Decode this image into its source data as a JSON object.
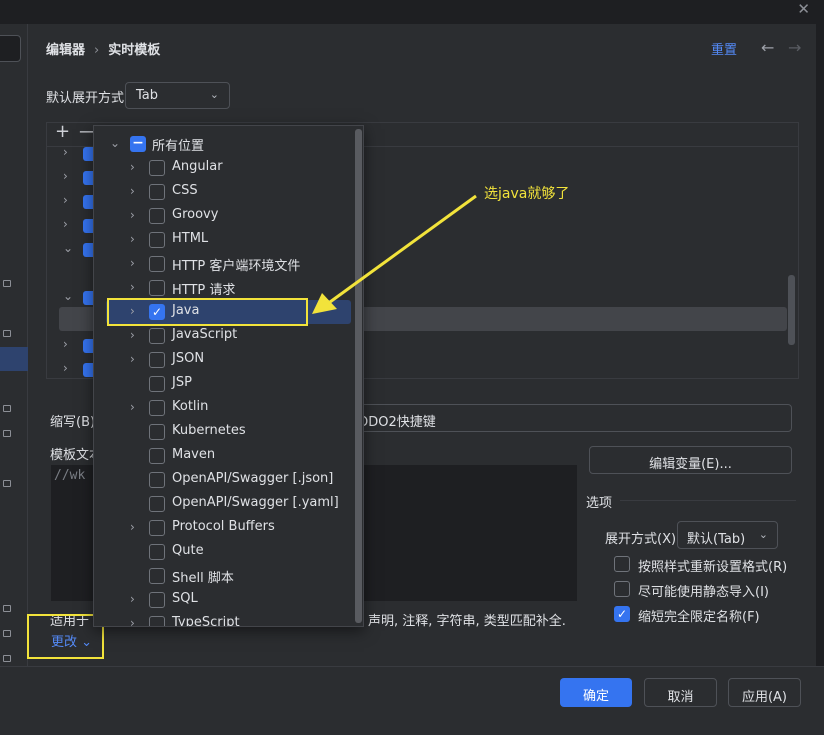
{
  "window": {
    "close_glyph": "✕"
  },
  "header": {
    "crumbs": [
      "编辑器",
      "实时模板"
    ],
    "separator": "›",
    "reset": "重置",
    "back_glyph": "←",
    "forward_glyph": "→"
  },
  "expand_default": {
    "label": "默认展开方式",
    "value": "Tab"
  },
  "tree_toolbar": {
    "add": "+",
    "remove": "—"
  },
  "popup": {
    "root": {
      "label": "所有位置",
      "state": "partial"
    },
    "items": [
      {
        "label": "Angular",
        "expandable": true,
        "checked": false
      },
      {
        "label": "CSS",
        "expandable": true,
        "checked": false
      },
      {
        "label": "Groovy",
        "expandable": true,
        "checked": false
      },
      {
        "label": "HTML",
        "expandable": true,
        "checked": false
      },
      {
        "label": "HTTP 客户端环境文件",
        "expandable": true,
        "checked": false
      },
      {
        "label": "HTTP 请求",
        "expandable": true,
        "checked": false
      },
      {
        "label": "Java",
        "expandable": true,
        "checked": true,
        "selected": true
      },
      {
        "label": "JavaScript",
        "expandable": true,
        "checked": false
      },
      {
        "label": "JSON",
        "expandable": true,
        "checked": false
      },
      {
        "label": "JSP",
        "expandable": false,
        "checked": false
      },
      {
        "label": "Kotlin",
        "expandable": true,
        "checked": false
      },
      {
        "label": "Kubernetes",
        "expandable": false,
        "checked": false
      },
      {
        "label": "Maven",
        "expandable": false,
        "checked": false
      },
      {
        "label": "OpenAPI/Swagger [.json]",
        "expandable": false,
        "checked": false
      },
      {
        "label": "OpenAPI/Swagger [.yaml]",
        "expandable": false,
        "checked": false
      },
      {
        "label": "Protocol Buffers",
        "expandable": true,
        "checked": false
      },
      {
        "label": "Qute",
        "expandable": false,
        "checked": false
      },
      {
        "label": "Shell 脚本",
        "expandable": false,
        "checked": false
      },
      {
        "label": "SQL",
        "expandable": true,
        "checked": false
      },
      {
        "label": "TypeScript",
        "expandable": true,
        "checked": false
      }
    ]
  },
  "annotation": {
    "text": "选java就够了",
    "color": "#f2e33b"
  },
  "editor": {
    "abbr_label": "缩写(B):",
    "description": "ODO2快捷键",
    "template_label": "模板文本",
    "template_text": "//wk",
    "edit_vars": "编辑变量(E)...",
    "applies_label": "适用于",
    "applies_tail": "声明, 注释, 字符串, 类型匹配补全.",
    "change": "更改 ⌄"
  },
  "options": {
    "title": "选项",
    "expand_label": "展开方式(X)",
    "expand_value": "默认(Tab)",
    "checkboxes": [
      {
        "label": "按照样式重新设置格式(R)",
        "checked": false
      },
      {
        "label": "尽可能使用静态导入(I)",
        "checked": false
      },
      {
        "label": "缩短完全限定名称(F)",
        "checked": true
      }
    ]
  },
  "footer": {
    "ok": "确定",
    "cancel": "取消",
    "apply": "应用(A)"
  },
  "colors": {
    "accent": "#3574f0",
    "link": "#548af7",
    "highlight": "#f2e33b"
  }
}
